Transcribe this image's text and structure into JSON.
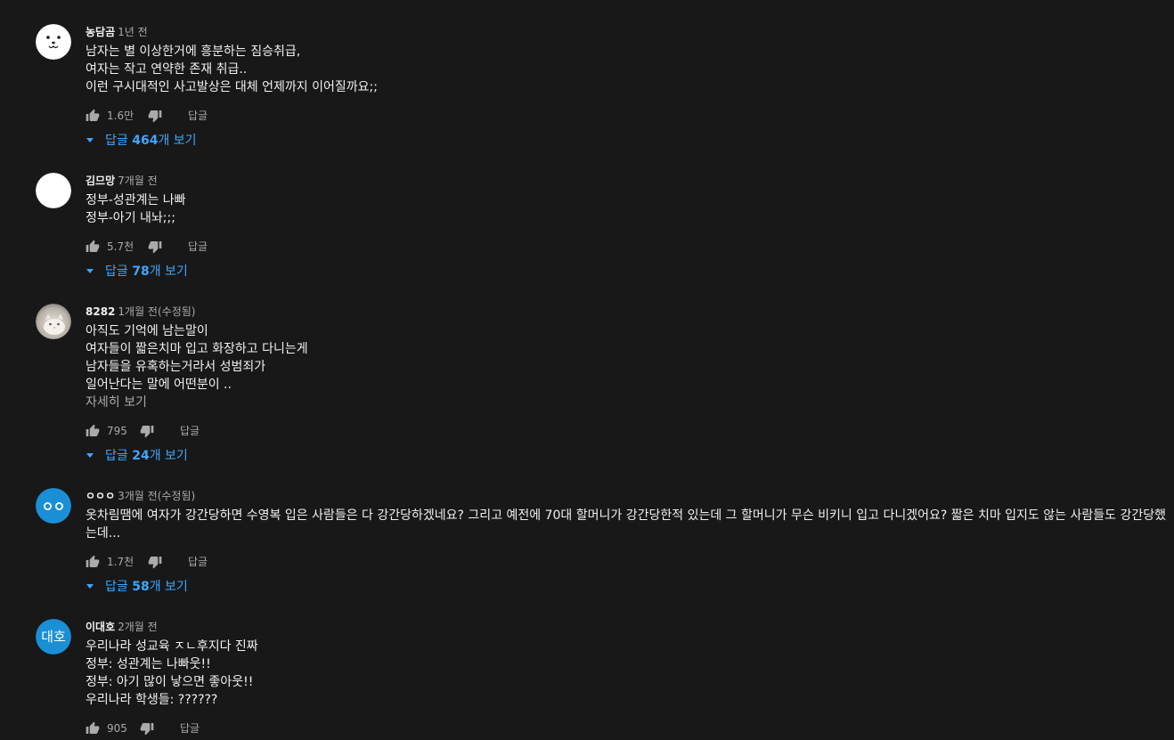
{
  "ui": {
    "reply_label": "답글",
    "replies_prefix": "답글 ",
    "replies_suffix": "개 보기",
    "read_more_label": "자세히 보기"
  },
  "colors": {
    "background": "#181818",
    "text_primary": "#f1f1f1",
    "text_secondary": "#aaaaaa",
    "link_blue": "#3ea6ff",
    "avatar_blue": "#1a8fd6"
  },
  "comments": [
    {
      "author": "농담곰",
      "time": "1년 전",
      "avatar_icon": "bear-face-avatar",
      "lines": [
        "남자는 별 이상한거에 흥분하는 짐승취급,",
        "여자는 작고 연약한 존재 취급..",
        "이런 구시대적인 사고발상은 대체 언제까지 이어질까요;;"
      ],
      "likes": "1.6만",
      "reply_count": "464"
    },
    {
      "author": "김므망",
      "time": "7개월 전",
      "avatar_icon": "blank-white-avatar",
      "lines": [
        "정부-성관계는 나빠",
        "정부-아기 내놔;;;"
      ],
      "likes": "5.7천",
      "reply_count": "78"
    },
    {
      "author": "8282",
      "time": "1개월 전(수정됨)",
      "avatar_icon": "cat-photo-avatar",
      "lines": [
        "아직도 기억에 남는말이",
        "여자들이 짧은치마 입고 화장하고 다니는게",
        "남자들을 유혹하는거라서 성범죄가",
        "일어난다는 말에 어떤분이 .."
      ],
      "read_more": true,
      "likes": "795",
      "reply_count": "24"
    },
    {
      "author": "ㅇㅇㅇ",
      "time": "3개월 전(수정됨)",
      "avatar_icon": "two-circles-avatar",
      "paragraph": "옷차림땜에 여자가 강간당하면 수영복 입은 사람들은 다 강간당하겠네요? 그리고 예전에 70대 할머니가 강간당한적 있는데 그 할머니가 무슨 비키니 입고 다니겠어요? 짧은 치마 입지도 않는 사람들도 강간당했는데...",
      "likes": "1.7천",
      "reply_count": "58"
    },
    {
      "author": "이대호",
      "time": "2개월 전",
      "avatar_icon": "text-initials-avatar",
      "avatar_text": "대호",
      "lines": [
        "우리나라 성교육 ㅈㄴ후지다 진짜",
        "정부: 성관계는 나빠웃!!",
        "정부: 아기 많이 낳으면 좋아웃!!",
        "우리나라 학생들: ??????"
      ],
      "likes": "905"
    }
  ]
}
